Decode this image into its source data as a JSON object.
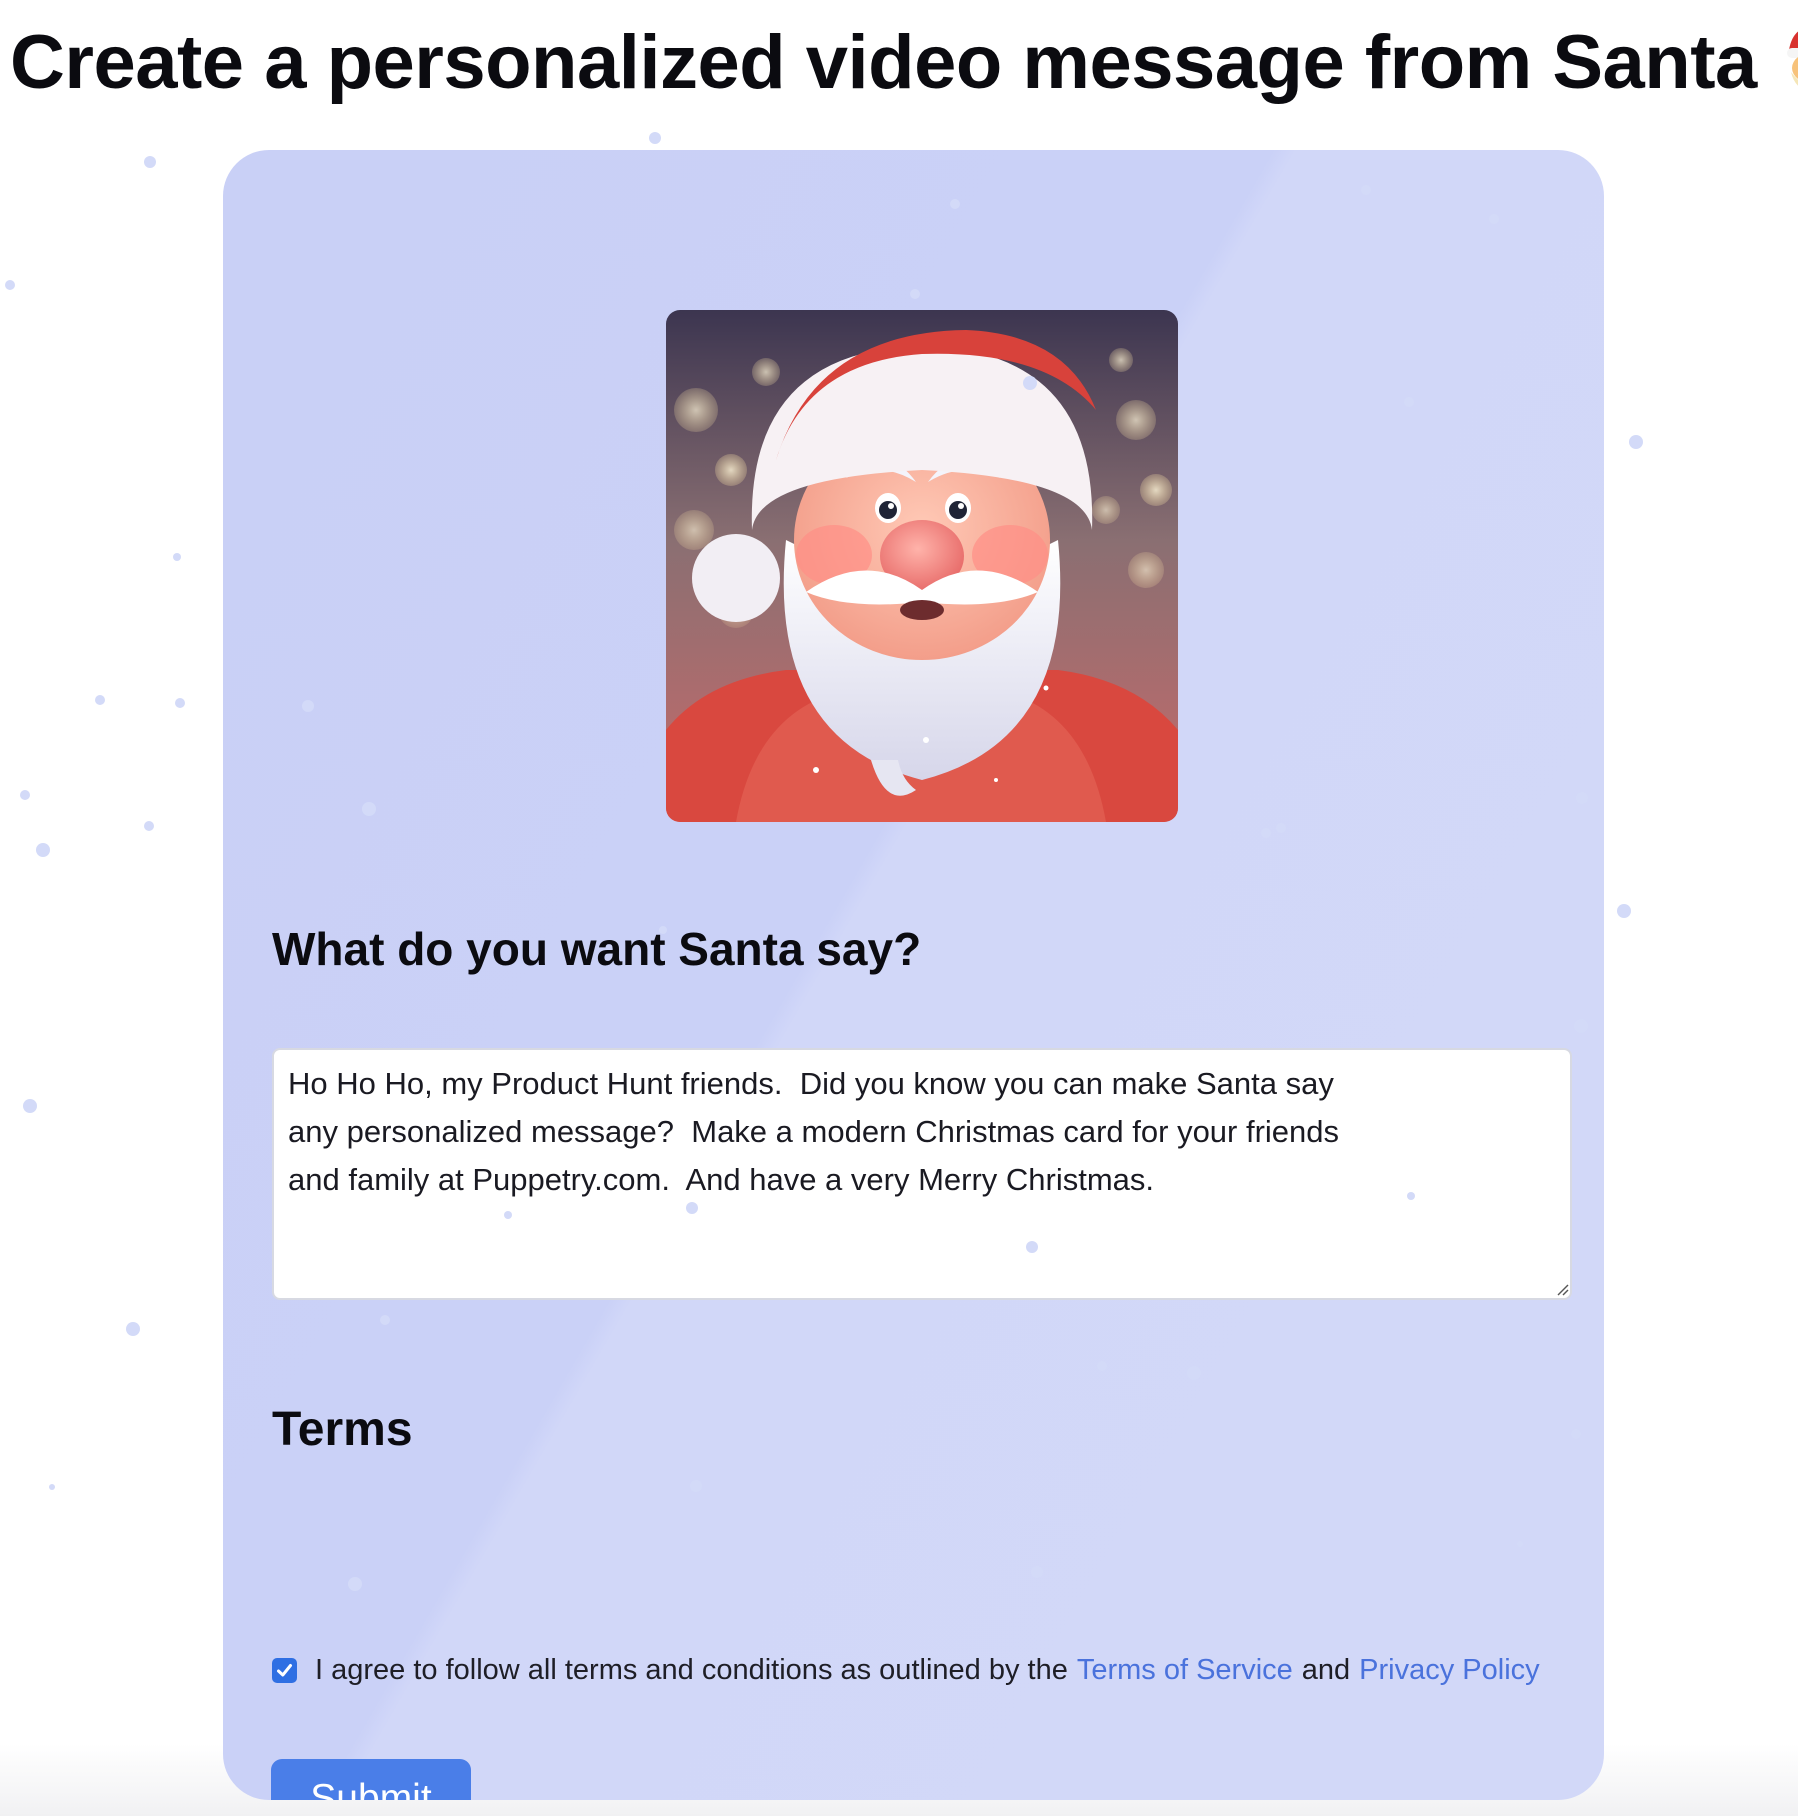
{
  "page": {
    "title": "Create a personalized video message from Santa",
    "title_emoji": "santa-claus-emoji"
  },
  "form": {
    "image": "santa-claus-portrait",
    "say_heading": "What do you want Santa say?",
    "message_value": "Ho Ho Ho, my Product Hunt friends.  Did you know you can make Santa say\nany personalized message?  Make a modern Christmas card for your friends\nand family at Puppetry.com.  And have a very Merry Christmas.",
    "terms_heading": "Terms",
    "terms_checked": true,
    "terms_text": "I agree to follow all terms and conditions as outlined by the",
    "terms_link": "Terms of Service",
    "and_text": "and",
    "privacy_link": "Privacy Policy",
    "submit_label": "Submit"
  },
  "colors": {
    "card_background": "#cad1f7",
    "link": "#4a72dc",
    "button": "#4a7ee8",
    "checkbox": "#2f6fe3"
  }
}
